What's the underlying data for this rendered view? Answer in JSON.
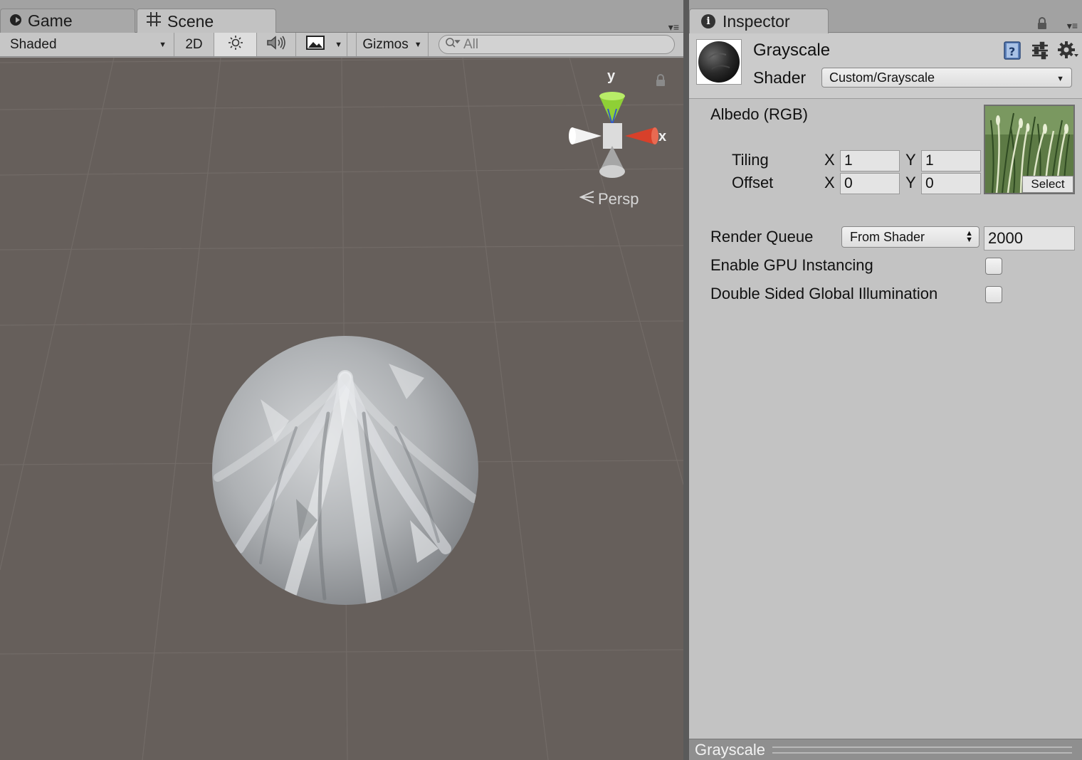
{
  "scene_tabs": {
    "game_label": "Game",
    "scene_label": "Scene"
  },
  "scene_toolbar": {
    "draw_mode": "Shaded",
    "mode_2d": "2D",
    "gizmos_label": "Gizmos",
    "search_placeholder": "All"
  },
  "viewport": {
    "axis_y": "y",
    "axis_x": "x",
    "projection": "Persp",
    "background_color": "#665f5b"
  },
  "inspector": {
    "tab_label": "Inspector",
    "material_name": "Grayscale",
    "shader_label": "Shader",
    "shader_value": "Custom/Grayscale",
    "albedo_label": "Albedo (RGB)",
    "tiling_label": "Tiling",
    "offset_label": "Offset",
    "x_label": "X",
    "y_label": "Y",
    "tiling_x": "1",
    "tiling_y": "1",
    "offset_x": "0",
    "offset_y": "0",
    "select_label": "Select",
    "render_queue_label": "Render Queue",
    "render_queue_mode": "From Shader",
    "render_queue_value": "2000",
    "gpu_instancing_label": "Enable GPU Instancing",
    "double_sided_gi_label": "Double Sided Global Illumination",
    "footer_title": "Grayscale"
  },
  "colors": {
    "axis_x": "#d8402a",
    "axis_y": "#8fd036",
    "panel_bg": "#c3c3c3"
  },
  "icons": [
    "game-icon",
    "scene-grid-icon",
    "sun-icon",
    "audio-icon",
    "image-effects-icon",
    "search-icon",
    "lock-icon",
    "info-icon",
    "help-book-icon",
    "sliders-icon",
    "gear-icon",
    "persp-icon",
    "tab-menu-icon"
  ]
}
